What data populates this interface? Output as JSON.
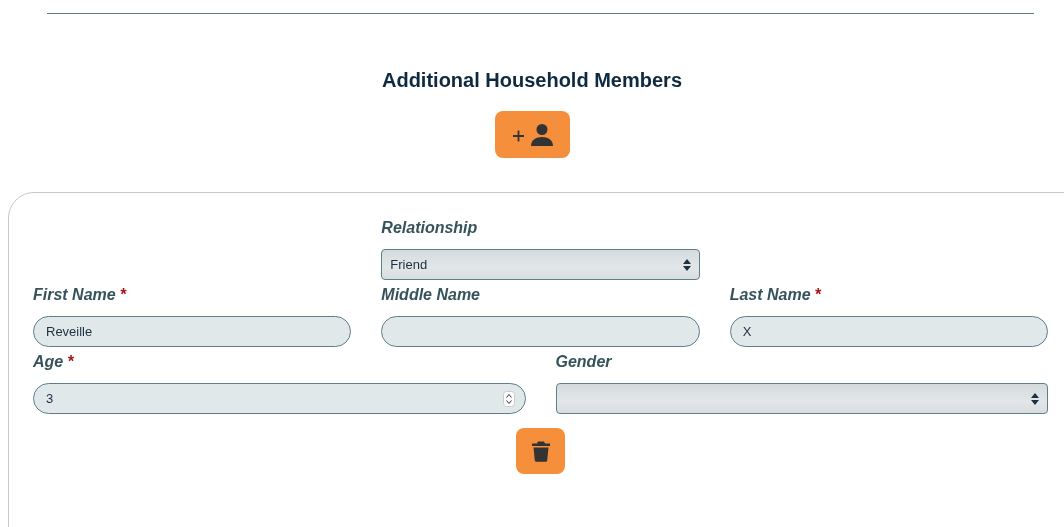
{
  "heading": "Additional Household Members",
  "member": {
    "rows": [
      [
        {
          "kind": "select",
          "label": "Relationship",
          "value": "Friend"
        }
      ],
      [
        {
          "kind": "text",
          "label": "First Name",
          "required_mark": "*",
          "value": "Reveille"
        },
        {
          "kind": "text",
          "label": "Middle Name"
        },
        {
          "kind": "text",
          "label": "Last Name",
          "required_mark": "*",
          "value": "X"
        }
      ],
      [
        {
          "kind": "number",
          "label": "Age",
          "required_mark": "*",
          "value": "3"
        },
        {
          "kind": "select",
          "label": "Gender"
        }
      ]
    ]
  }
}
